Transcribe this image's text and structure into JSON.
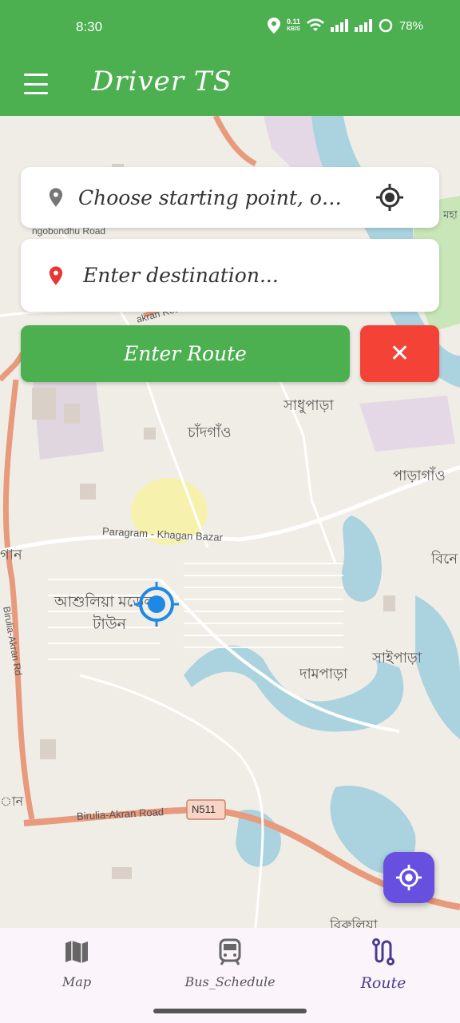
{
  "status_bar": {
    "time": "8:30",
    "net_speed_value": "0.11",
    "net_speed_unit": "KB/S",
    "battery": "78%"
  },
  "app_bar": {
    "title": "Driver TS"
  },
  "search": {
    "start_placeholder": "Choose starting point, o…",
    "destination_placeholder": "Enter destination..."
  },
  "actions": {
    "enter_route_label": "Enter Route",
    "clear_label": "✕"
  },
  "map_labels": {
    "bondhu_road": "ngobondhu Road",
    "chandgaon": "চাঁদগাঁও",
    "sadhupara": "সাধুপাড়া",
    "paragaon": "পাড়াগাঁও",
    "paragram_khagan": "Paragram - Khagan Bazar",
    "ashulia_model_town_1": "আশুলিয়া মডেল",
    "ashulia_model_town_2": "টাউন",
    "gan": "গান",
    "bine": "বিনে",
    "saipara": "সাইপাড়া",
    "dampara": "দামপাড়া",
    "birulia_akran_rd": "Birulia-Akran Rd",
    "birulia_akran_road": "Birulia-Akran Road",
    "n511": "N511",
    "birulia": "বিরুলিয়া",
    "mohan": "মহা",
    "akran": "akran Road",
    "an": "ান"
  },
  "bottom_nav": {
    "items": [
      {
        "label": "Map",
        "icon": "map-icon"
      },
      {
        "label": "Bus_Schedule",
        "icon": "bus-icon"
      },
      {
        "label": "Route",
        "icon": "route-icon"
      }
    ],
    "active": "Route"
  },
  "colors": {
    "primary": "#4caf50",
    "danger": "#f44336",
    "fab": "#6750e0",
    "nav_bg": "#fcf4fb"
  }
}
